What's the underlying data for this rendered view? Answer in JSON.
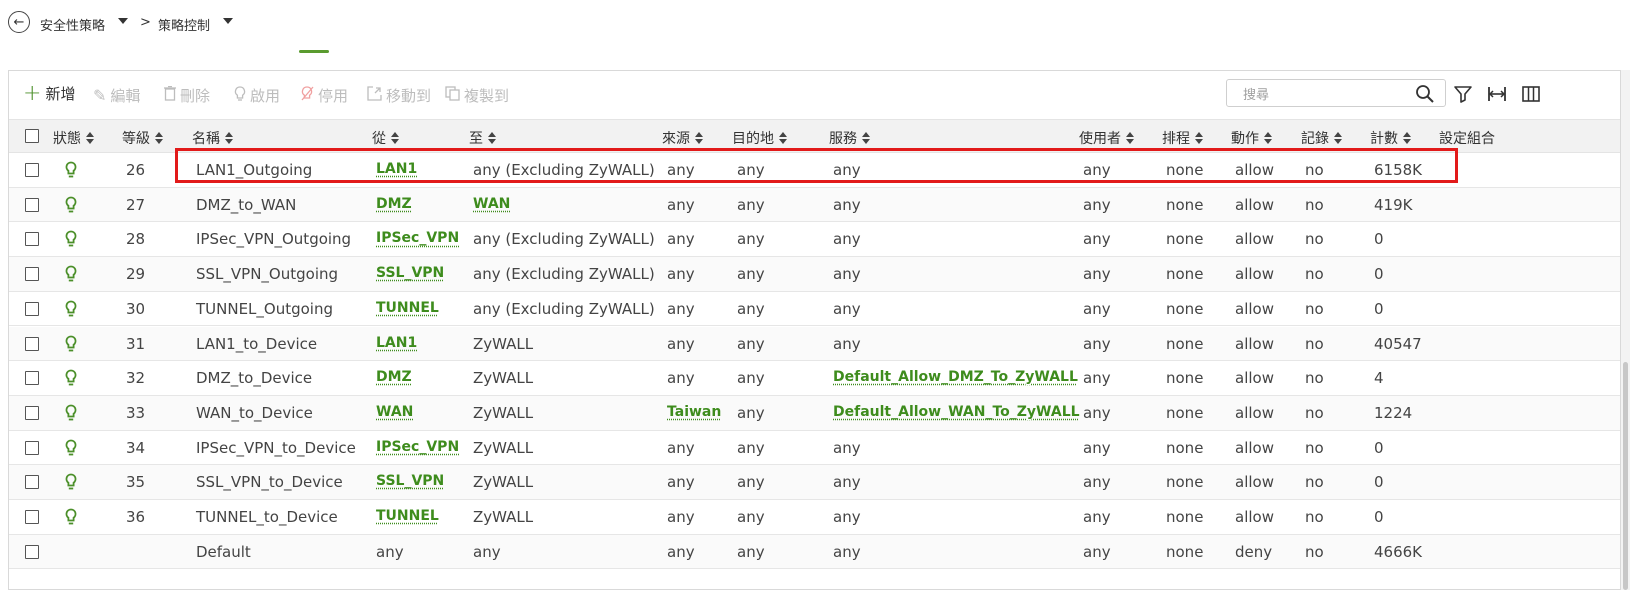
{
  "breadcrumb": {
    "level1": "安全性策略",
    "separator": ">",
    "level2": "策略控制"
  },
  "toolbar": {
    "add": "新增",
    "edit": "編輯",
    "delete": "刪除",
    "enable": "啟用",
    "disable": "停用",
    "move_to": "移動到",
    "copy_to": "複製到",
    "search_placeholder": "搜尋"
  },
  "columns": {
    "status": "狀態",
    "priority": "等級",
    "name": "名稱",
    "from": "從",
    "to": "至",
    "source": "來源",
    "destination": "目的地",
    "service": "服務",
    "user": "使用者",
    "schedule": "排程",
    "action": "動作",
    "log": "記錄",
    "count": "計數",
    "profile": "設定組合"
  },
  "colors": {
    "accent": "#4b8f29",
    "link": "#3e8c1d",
    "highlight": "#e21a1a"
  },
  "rows": [
    {
      "status_icon": "bulb-icon",
      "priority": "26",
      "name": "LAN1_Outgoing",
      "from": "LAN1",
      "from_link": true,
      "to": "any (Excluding ZyWALL)",
      "to_link": false,
      "source": "any",
      "source_link": false,
      "destination": "any",
      "service": "any",
      "service_link": false,
      "user": "any",
      "schedule": "none",
      "action": "allow",
      "log": "no",
      "count": "6158K"
    },
    {
      "status_icon": "bulb-icon",
      "priority": "27",
      "name": "DMZ_to_WAN",
      "from": "DMZ",
      "from_link": true,
      "to": "WAN",
      "to_link": true,
      "source": "any",
      "source_link": false,
      "destination": "any",
      "service": "any",
      "service_link": false,
      "user": "any",
      "schedule": "none",
      "action": "allow",
      "log": "no",
      "count": "419K"
    },
    {
      "status_icon": "bulb-icon",
      "priority": "28",
      "name": "IPSec_VPN_Outgoing",
      "from": "IPSec_VPN",
      "from_link": true,
      "to": "any (Excluding ZyWALL)",
      "to_link": false,
      "source": "any",
      "source_link": false,
      "destination": "any",
      "service": "any",
      "service_link": false,
      "user": "any",
      "schedule": "none",
      "action": "allow",
      "log": "no",
      "count": "0"
    },
    {
      "status_icon": "bulb-icon",
      "priority": "29",
      "name": "SSL_VPN_Outgoing",
      "from": "SSL_VPN",
      "from_link": true,
      "to": "any (Excluding ZyWALL)",
      "to_link": false,
      "source": "any",
      "source_link": false,
      "destination": "any",
      "service": "any",
      "service_link": false,
      "user": "any",
      "schedule": "none",
      "action": "allow",
      "log": "no",
      "count": "0"
    },
    {
      "status_icon": "bulb-icon",
      "priority": "30",
      "name": "TUNNEL_Outgoing",
      "from": "TUNNEL",
      "from_link": true,
      "to": "any (Excluding ZyWALL)",
      "to_link": false,
      "source": "any",
      "source_link": false,
      "destination": "any",
      "service": "any",
      "service_link": false,
      "user": "any",
      "schedule": "none",
      "action": "allow",
      "log": "no",
      "count": "0"
    },
    {
      "status_icon": "bulb-icon",
      "priority": "31",
      "name": "LAN1_to_Device",
      "from": "LAN1",
      "from_link": true,
      "to": "ZyWALL",
      "to_link": false,
      "source": "any",
      "source_link": false,
      "destination": "any",
      "service": "any",
      "service_link": false,
      "user": "any",
      "schedule": "none",
      "action": "allow",
      "log": "no",
      "count": "40547"
    },
    {
      "status_icon": "bulb-icon",
      "priority": "32",
      "name": "DMZ_to_Device",
      "from": "DMZ",
      "from_link": true,
      "to": "ZyWALL",
      "to_link": false,
      "source": "any",
      "source_link": false,
      "destination": "any",
      "service": "Default_Allow_DMZ_To_ZyWALL",
      "service_link": true,
      "user": "any",
      "schedule": "none",
      "action": "allow",
      "log": "no",
      "count": "4"
    },
    {
      "status_icon": "bulb-icon",
      "priority": "33",
      "name": "WAN_to_Device",
      "from": "WAN",
      "from_link": true,
      "to": "ZyWALL",
      "to_link": false,
      "source": "Taiwan",
      "source_link": true,
      "destination": "any",
      "service": "Default_Allow_WAN_To_ZyWALL",
      "service_link": true,
      "user": "any",
      "schedule": "none",
      "action": "allow",
      "log": "no",
      "count": "1224"
    },
    {
      "status_icon": "bulb-icon",
      "priority": "34",
      "name": "IPSec_VPN_to_Device",
      "from": "IPSec_VPN",
      "from_link": true,
      "to": "ZyWALL",
      "to_link": false,
      "source": "any",
      "source_link": false,
      "destination": "any",
      "service": "any",
      "service_link": false,
      "user": "any",
      "schedule": "none",
      "action": "allow",
      "log": "no",
      "count": "0"
    },
    {
      "status_icon": "bulb-icon",
      "priority": "35",
      "name": "SSL_VPN_to_Device",
      "from": "SSL_VPN",
      "from_link": true,
      "to": "ZyWALL",
      "to_link": false,
      "source": "any",
      "source_link": false,
      "destination": "any",
      "service": "any",
      "service_link": false,
      "user": "any",
      "schedule": "none",
      "action": "allow",
      "log": "no",
      "count": "0"
    },
    {
      "status_icon": "bulb-icon",
      "priority": "36",
      "name": "TUNNEL_to_Device",
      "from": "TUNNEL",
      "from_link": true,
      "to": "ZyWALL",
      "to_link": false,
      "source": "any",
      "source_link": false,
      "destination": "any",
      "service": "any",
      "service_link": false,
      "user": "any",
      "schedule": "none",
      "action": "allow",
      "log": "no",
      "count": "0"
    },
    {
      "status_icon": "",
      "priority": "",
      "name": "Default",
      "from": "any",
      "from_link": false,
      "to": "any",
      "to_link": false,
      "source": "any",
      "source_link": false,
      "destination": "any",
      "service": "any",
      "service_link": false,
      "user": "any",
      "schedule": "none",
      "action": "deny",
      "log": "no",
      "count": "4666K"
    }
  ]
}
